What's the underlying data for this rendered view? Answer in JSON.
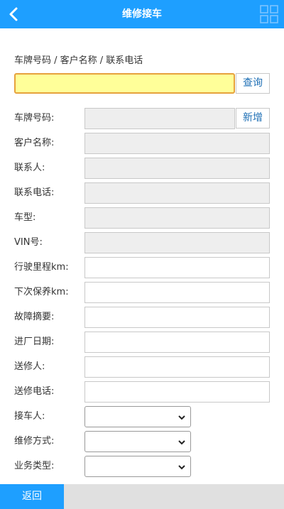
{
  "header": {
    "title": "维修接车",
    "back_icon": "chevron-left-icon",
    "menu_icon": "grid-icon"
  },
  "search": {
    "caption": "车牌号码 / 客户名称 / 联系电话",
    "value": "",
    "button": "查询"
  },
  "form": {
    "add_button": "新增",
    "plate_label": "车牌号码:",
    "customer_label": "客户名称:",
    "contact_label": "联系人:",
    "phone_label": "联系电话:",
    "model_label": "车型:",
    "vin_label": "VIN号:",
    "mileage_label": "行驶里程km:",
    "next_service_label": "下次保养km:",
    "fault_label": "故障摘要:",
    "entry_date_label": "进厂日期:",
    "sender_label": "送修人:",
    "sender_phone_label": "送修电话:",
    "receiver_label": "接车人:",
    "repair_method_label": "维修方式:",
    "business_type_label": "业务类型:"
  },
  "footer": {
    "back_label": "返回"
  },
  "colors": {
    "primary": "#1e9fff",
    "search_bg": "#ffff99",
    "search_border": "#e6a23c",
    "readonly_bg": "#eeeeee"
  }
}
